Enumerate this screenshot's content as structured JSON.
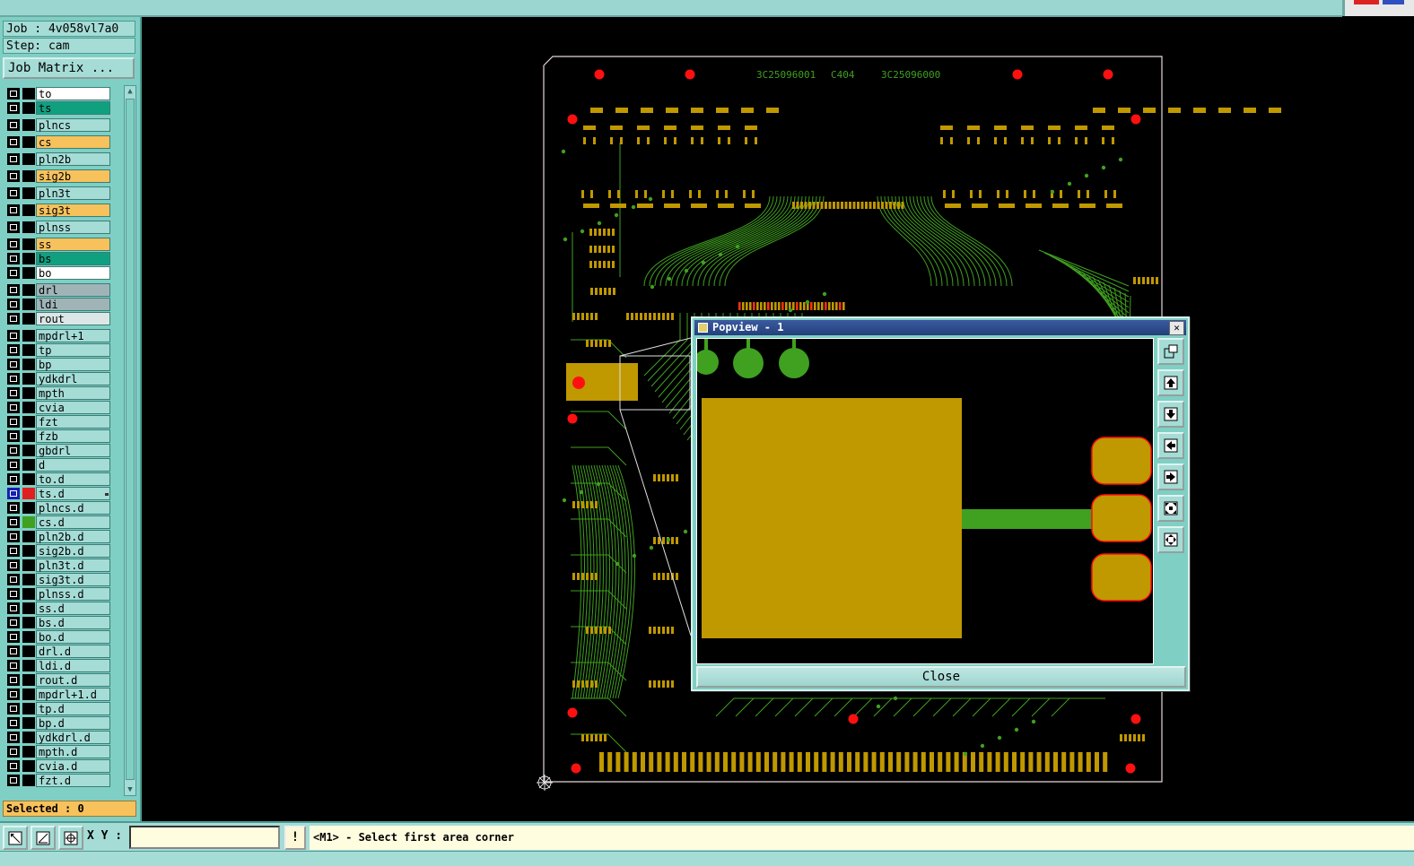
{
  "job": {
    "label": "Job : 4v058vl7a0",
    "step": "Step: cam",
    "matrix_button": "Job Matrix ..."
  },
  "layers": [
    {
      "name": "to",
      "color": "#ffffff",
      "checked": false,
      "sw": "#000000"
    },
    {
      "name": "ts",
      "color": "#10a080",
      "checked": false,
      "sw": "#000000"
    },
    {
      "name": "plncs",
      "color": "#a5dcd6",
      "checked": false,
      "sw": "#000000"
    },
    {
      "name": "cs",
      "color": "#f7c15c",
      "checked": false,
      "sw": "#000000"
    },
    {
      "name": "pln2b",
      "color": "#a5dcd6",
      "checked": false,
      "sw": "#000000"
    },
    {
      "name": "sig2b",
      "color": "#f7c15c",
      "checked": false,
      "sw": "#000000"
    },
    {
      "name": "pln3t",
      "color": "#a5dcd6",
      "checked": false,
      "sw": "#000000"
    },
    {
      "name": "sig3t",
      "color": "#f7c15c",
      "checked": false,
      "sw": "#000000"
    },
    {
      "name": "plnss",
      "color": "#a5dcd6",
      "checked": false,
      "sw": "#000000"
    },
    {
      "name": "ss",
      "color": "#f7c15c",
      "checked": false,
      "sw": "#000000"
    },
    {
      "name": "bs",
      "color": "#10a080",
      "checked": false,
      "sw": "#000000"
    },
    {
      "name": "bo",
      "color": "#ffffff",
      "checked": false,
      "sw": "#000000"
    },
    {
      "name": "drl",
      "color": "#a0b4b8",
      "checked": false,
      "sw": "#000000"
    },
    {
      "name": "ldi",
      "color": "#a0b4b8",
      "checked": false,
      "sw": "#000000"
    },
    {
      "name": "rout",
      "color": "#dde6e6",
      "checked": false,
      "sw": "#000000"
    },
    {
      "name": "mpdrl+1",
      "color": "#a5dcd6",
      "checked": false,
      "sw": "#000000"
    },
    {
      "name": "tp",
      "color": "#a5dcd6",
      "checked": false,
      "sw": "#000000"
    },
    {
      "name": "bp",
      "color": "#a5dcd6",
      "checked": false,
      "sw": "#000000"
    },
    {
      "name": "ydkdrl",
      "color": "#a5dcd6",
      "checked": false,
      "sw": "#000000"
    },
    {
      "name": "mpth",
      "color": "#a5dcd6",
      "checked": false,
      "sw": "#000000"
    },
    {
      "name": "cvia",
      "color": "#a5dcd6",
      "checked": false,
      "sw": "#000000"
    },
    {
      "name": "fzt",
      "color": "#a5dcd6",
      "checked": false,
      "sw": "#000000"
    },
    {
      "name": "fzb",
      "color": "#a5dcd6",
      "checked": false,
      "sw": "#000000"
    },
    {
      "name": "gbdrl",
      "color": "#a5dcd6",
      "checked": false,
      "sw": "#000000"
    },
    {
      "name": "d",
      "color": "#a5dcd6",
      "checked": false,
      "sw": "#000000"
    },
    {
      "name": "to.d",
      "color": "#a5dcd6",
      "checked": false,
      "sw": "#000000"
    },
    {
      "name": "ts.d",
      "color": "#a5dcd6",
      "checked": true,
      "sw": "#e02020"
    },
    {
      "name": "plncs.d",
      "color": "#a5dcd6",
      "checked": false,
      "sw": "#000000"
    },
    {
      "name": "cs.d",
      "color": "#a5dcd6",
      "checked": false,
      "sw": "#40a020"
    },
    {
      "name": "pln2b.d",
      "color": "#a5dcd6",
      "checked": false,
      "sw": "#000000"
    },
    {
      "name": "sig2b.d",
      "color": "#a5dcd6",
      "checked": false,
      "sw": "#000000"
    },
    {
      "name": "pln3t.d",
      "color": "#a5dcd6",
      "checked": false,
      "sw": "#000000"
    },
    {
      "name": "sig3t.d",
      "color": "#a5dcd6",
      "checked": false,
      "sw": "#000000"
    },
    {
      "name": "plnss.d",
      "color": "#a5dcd6",
      "checked": false,
      "sw": "#000000"
    },
    {
      "name": "ss.d",
      "color": "#a5dcd6",
      "checked": false,
      "sw": "#000000"
    },
    {
      "name": "bs.d",
      "color": "#a5dcd6",
      "checked": false,
      "sw": "#000000"
    },
    {
      "name": "bo.d",
      "color": "#a5dcd6",
      "checked": false,
      "sw": "#000000"
    },
    {
      "name": "drl.d",
      "color": "#a5dcd6",
      "checked": false,
      "sw": "#000000"
    },
    {
      "name": "ldi.d",
      "color": "#a5dcd6",
      "checked": false,
      "sw": "#000000"
    },
    {
      "name": "rout.d",
      "color": "#a5dcd6",
      "checked": false,
      "sw": "#000000"
    },
    {
      "name": "mpdrl+1.d",
      "color": "#a5dcd6",
      "checked": false,
      "sw": "#000000"
    },
    {
      "name": "tp.d",
      "color": "#a5dcd6",
      "checked": false,
      "sw": "#000000"
    },
    {
      "name": "bp.d",
      "color": "#a5dcd6",
      "checked": false,
      "sw": "#000000"
    },
    {
      "name": "ydkdrl.d",
      "color": "#a5dcd6",
      "checked": false,
      "sw": "#000000"
    },
    {
      "name": "mpth.d",
      "color": "#a5dcd6",
      "checked": false,
      "sw": "#000000"
    },
    {
      "name": "cvia.d",
      "color": "#a5dcd6",
      "checked": false,
      "sw": "#000000"
    },
    {
      "name": "fzt.d",
      "color": "#a5dcd6",
      "checked": false,
      "sw": "#000000"
    }
  ],
  "selected": "Selected : 0",
  "board": {
    "labels": [
      "3C25096001",
      "C404",
      "3C25096000"
    ],
    "colors": {
      "pad": "#c09800",
      "trace": "#40a020",
      "hole": "#ff1010",
      "outline": "#e8d8d8"
    }
  },
  "popview": {
    "title": "Popview - 1",
    "close_label": "Close",
    "tools": [
      "zoom-window-icon",
      "pan-up-icon",
      "pan-down-icon",
      "pan-left-icon",
      "pan-right-icon",
      "zoom-fit-icon",
      "zoom-home-icon"
    ]
  },
  "bottom": {
    "xy_label": "X Y :",
    "xy_value": "",
    "prompt": "<M1> - Select first area corner"
  }
}
